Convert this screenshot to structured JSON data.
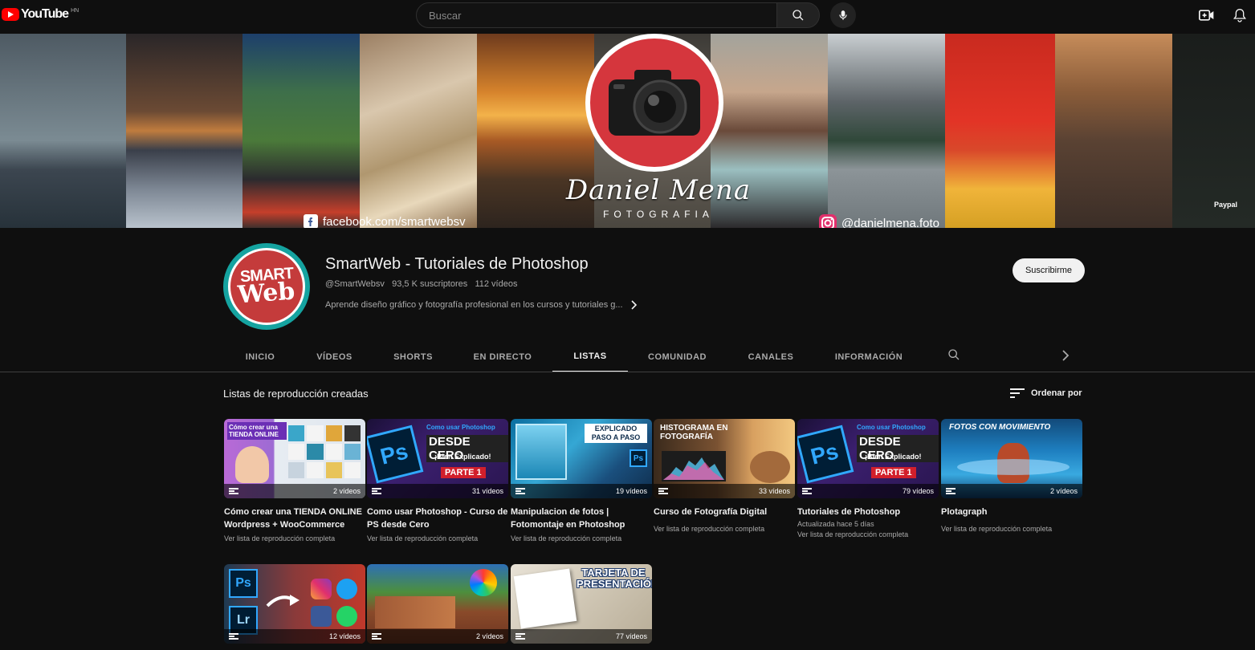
{
  "topbar": {
    "logo_text": "YouTube",
    "country": "HN",
    "search_placeholder": "Buscar"
  },
  "banner": {
    "signature": "Daniel Mena",
    "subtitle": "FOTOGRAFIA",
    "facebook": "facebook.com/smartwebsv",
    "instagram": "@danielmena.foto",
    "paypal": "Paypal"
  },
  "channel": {
    "avatar_line1": "SMART",
    "avatar_line2": "Web",
    "title": "SmartWeb - Tutoriales de Photoshop",
    "handle": "@SmartWebsv",
    "subscribers": "93,5 K suscriptores",
    "videos": "112 vídeos",
    "description": "Aprende diseño gráfico y fotografía profesional en los cursos y tutoriales g...",
    "subscribe_label": "Suscribirme"
  },
  "tabs": [
    {
      "label": "INICIO"
    },
    {
      "label": "VÍDEOS"
    },
    {
      "label": "SHORTS"
    },
    {
      "label": "EN DIRECTO"
    },
    {
      "label": "LISTAS"
    },
    {
      "label": "COMUNIDAD"
    },
    {
      "label": "CANALES"
    },
    {
      "label": "INFORMACIÓN"
    }
  ],
  "section": {
    "title": "Listas de reproducción creadas",
    "sort_label": "Ordenar por"
  },
  "playlists": [
    {
      "title": "Cómo crear una TIENDA ONLINE Wordpress + WooCommerce",
      "count": "2 vídeos",
      "sub": "",
      "link": "Ver lista de reproducción completa",
      "thumb_text": "Cómo crear una TIENDA ONLINE"
    },
    {
      "title": "Como usar Photoshop - Curso de PS desde Cero",
      "count": "31 vídeos",
      "sub": "",
      "link": "Ver lista de reproducción completa",
      "thumb_text": "DESDE CERO"
    },
    {
      "title": "Manipulacion de fotos | Fotomontaje en Photoshop",
      "count": "19 vídeos",
      "sub": "",
      "link": "Ver lista de reproducción completa",
      "thumb_text": "EXPLICADO PASO A PASO"
    },
    {
      "title": "Curso de Fotografía Digital",
      "count": "33 vídeos",
      "sub": "",
      "link": "Ver lista de reproducción completa",
      "thumb_text": "HISTOGRAMA EN FOTOGRAFÍA"
    },
    {
      "title": "Tutoriales de Photoshop",
      "count": "79 vídeos",
      "sub": "Actualizada hace 5 días",
      "link": "Ver lista de reproducción completa",
      "thumb_text": "DESDE CERO"
    },
    {
      "title": "Plotagraph",
      "count": "2 vídeos",
      "sub": "",
      "link": "Ver lista de reproducción completa",
      "thumb_text": "FOTOS CON MOVIMIENTO"
    },
    {
      "title": "",
      "count": "12 vídeos",
      "sub": "",
      "link": "",
      "thumb_text": "Ps"
    },
    {
      "title": "",
      "count": "2 vídeos",
      "sub": "",
      "link": "",
      "thumb_text": ""
    },
    {
      "title": "",
      "count": "77 vídeos",
      "sub": "",
      "link": "",
      "thumb_text": "TARJETA DE PRESENTACIÓN"
    }
  ],
  "thumb_extras": {
    "ps": "Ps",
    "lr": "Lr",
    "parte": "PARTE 1",
    "bien": "¡Bien Explicado!",
    "como": "Como usar Photoshop"
  }
}
